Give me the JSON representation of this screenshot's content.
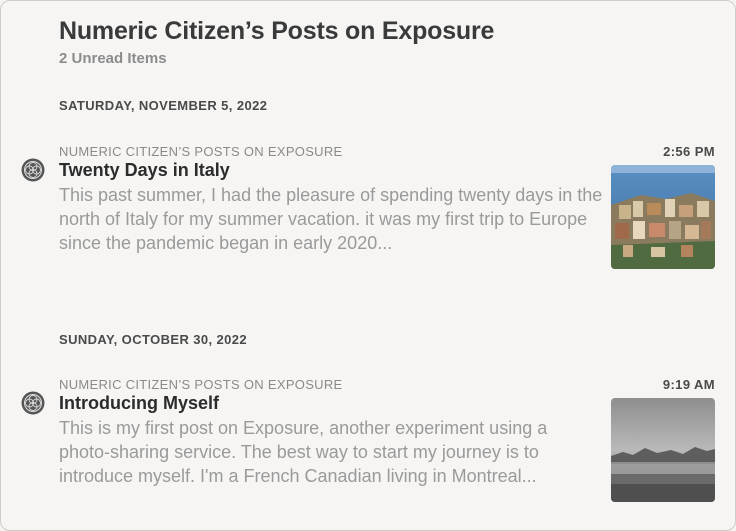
{
  "header": {
    "title": "Numeric Citizen’s Posts on Exposure",
    "unread": "2 Unread Items"
  },
  "sections": [
    {
      "date": "SATURDAY, NOVEMBER 5, 2022",
      "article": {
        "feed": "NUMERIC CITIZEN’S POSTS ON EXPOSURE",
        "time": "2:56 PM",
        "title": "Twenty Days in Italy",
        "summary": "This past summer, I had the pleasure of spending twenty days in the north of Italy for my summer vacation. it was my first trip to Europe since the pandemic began in early 2020...",
        "thumbnail_icon": "coastal-village-photo"
      }
    },
    {
      "date": "SUNDAY, OCTOBER 30, 2022",
      "article": {
        "feed": "NUMERIC CITIZEN’S POSTS ON EXPOSURE",
        "time": "9:19 AM",
        "title": "Introducing Myself",
        "summary": "This is my first post on Exposure, another experiment using a photo-sharing service. The best way to start my journey is to introduce myself. I'm a French Canadian living in Montreal...",
        "thumbnail_icon": "foggy-mountains-photo"
      }
    }
  ],
  "feed_icon": "exposure-logo-icon",
  "colors": {
    "background": "#f6f5f3",
    "summary_text": "#9a9a9a"
  }
}
